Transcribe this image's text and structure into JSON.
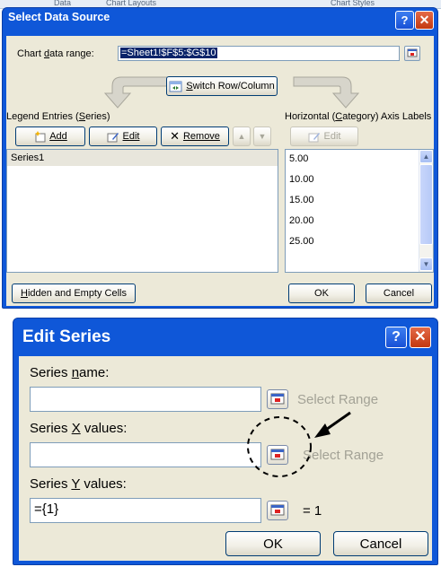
{
  "background": {
    "tab_left": "Data",
    "tab_mid": "Chart Layouts",
    "tab_right": "Chart Styles"
  },
  "select_data_source": {
    "title": "Select Data Source",
    "chart_range_label": "Chart data range:",
    "chart_range_value": "=Sheet1!$F$5:$G$10",
    "switch_label": "Switch Row/Column",
    "legend_header": "Legend Entries (Series)",
    "add_label": "Add",
    "edit_label": "Edit",
    "remove_label": "Remove",
    "series": [
      "Series1"
    ],
    "axis_header": "Horizontal (Category) Axis Labels",
    "axis_edit_label": "Edit",
    "axis_labels": [
      "5.00",
      "10.00",
      "15.00",
      "20.00",
      "25.00"
    ],
    "hidden_empty_label": "Hidden and Empty Cells",
    "ok_label": "OK",
    "cancel_label": "Cancel"
  },
  "edit_series": {
    "title": "Edit Series",
    "series_name_label": "Series name:",
    "series_name_value": "",
    "select_range_1": "Select Range",
    "x_values_label": "Series X values:",
    "x_values_value": "",
    "select_range_2": "Select Range",
    "y_values_label": "Series Y values:",
    "y_values_value": "={1}",
    "y_result": "= 1",
    "ok_label": "OK",
    "cancel_label": "Cancel"
  },
  "colors": {
    "title_bar": "#0f57d8",
    "dialog_face": "#ece9d8",
    "selection": "#0a246a"
  },
  "icons": [
    "help-icon",
    "close-icon",
    "range-selector-icon",
    "switch-icon",
    "add-icon",
    "edit-icon",
    "remove-icon",
    "move-up-icon",
    "move-down-icon",
    "arrow-pointer-icon"
  ]
}
